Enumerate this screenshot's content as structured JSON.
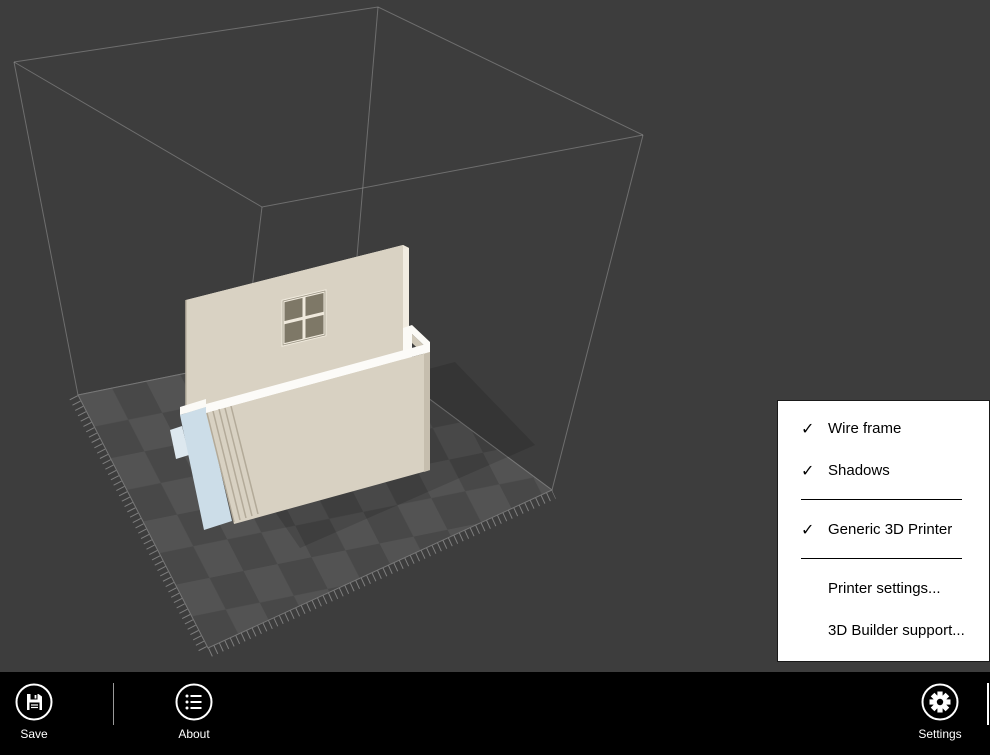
{
  "colors": {
    "background": "#3d3d3d",
    "appbar_bg": "#000000",
    "menu_bg": "#ffffff",
    "menu_text": "#000000",
    "wireframe": "#9f9f9f",
    "plate_dark": "#484848",
    "plate_light": "#535353",
    "model_face": "#d9d2c3",
    "model_face_front": "#d8d1c2",
    "model_side_shade": "#c6beae",
    "model_rim": "#fcfbf8",
    "model_accent_blue": "#ccdde8",
    "window_pane": "#7e7867"
  },
  "settings_menu": {
    "items": [
      {
        "label": "Wire frame",
        "check": "✓"
      },
      {
        "label": "Shadows",
        "check": "✓"
      },
      {
        "label": "Generic 3D Printer",
        "check": "✓"
      },
      {
        "label": "Printer settings...",
        "check": ""
      },
      {
        "label": "3D Builder support...",
        "check": ""
      }
    ]
  },
  "appbar": {
    "buttons": [
      {
        "label": "Save"
      },
      {
        "label": "About"
      },
      {
        "label": "Settings"
      }
    ]
  }
}
